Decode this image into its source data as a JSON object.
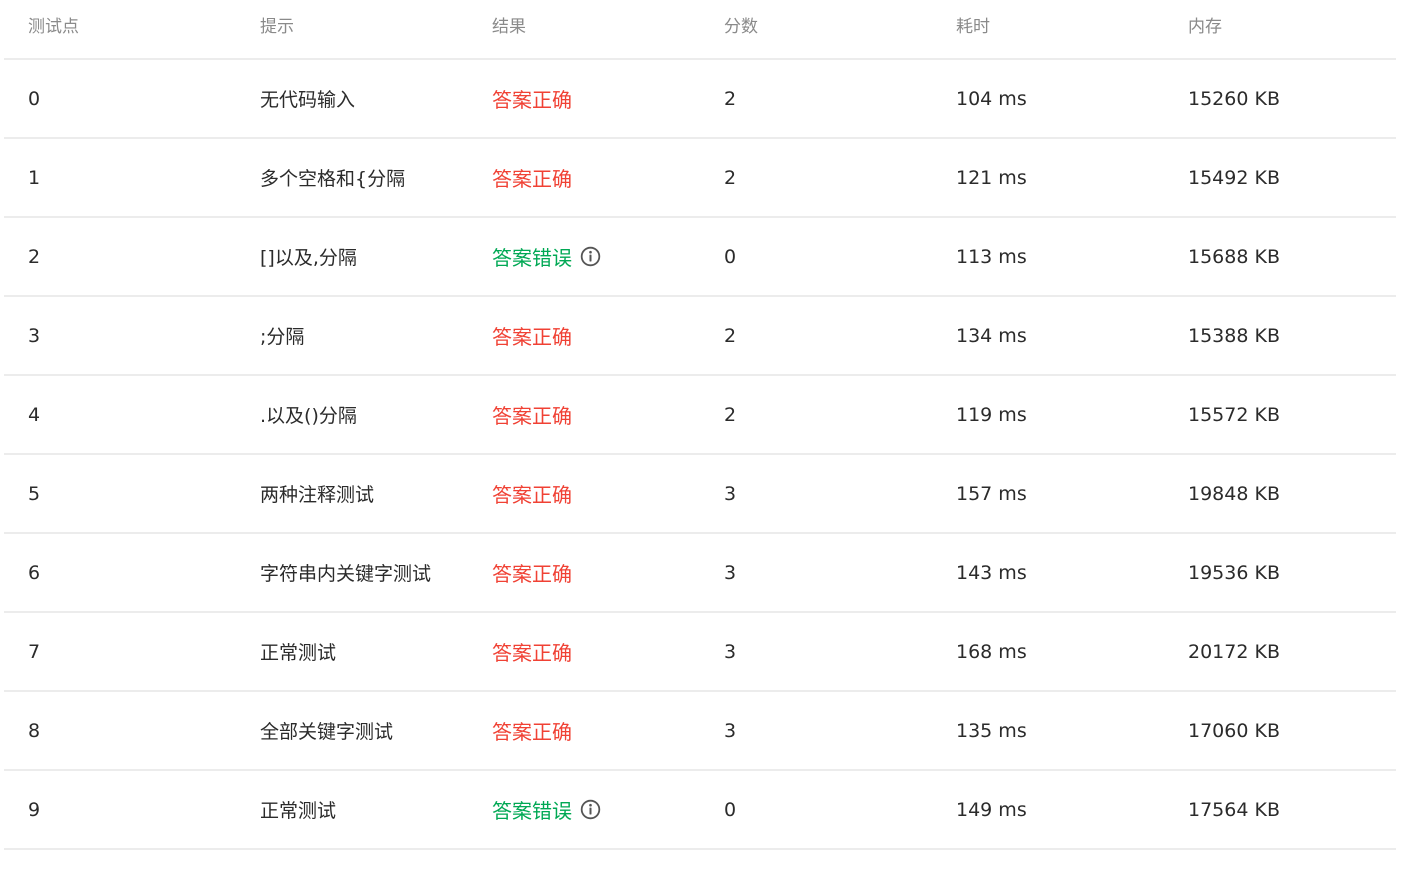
{
  "colors": {
    "correct": "#f04134",
    "wrong": "#00a854",
    "header_text": "#8a8a8a",
    "body_text": "#2b2b2b",
    "divider": "#ececec",
    "info_icon": "#555555"
  },
  "table": {
    "headers": [
      "测试点",
      "提示",
      "结果",
      "分数",
      "耗时",
      "内存"
    ],
    "rows": [
      {
        "id": "0",
        "hint": "无代码输入",
        "result": "答案正确",
        "status": "correct",
        "score": "2",
        "time": "104 ms",
        "memory": "15260 KB"
      },
      {
        "id": "1",
        "hint": "多个空格和{分隔",
        "result": "答案正确",
        "status": "correct",
        "score": "2",
        "time": "121 ms",
        "memory": "15492 KB"
      },
      {
        "id": "2",
        "hint": "[]以及,分隔",
        "result": "答案错误",
        "status": "wrong",
        "score": "0",
        "time": "113 ms",
        "memory": "15688 KB",
        "info_icon": "info-circle-icon"
      },
      {
        "id": "3",
        "hint": ";分隔",
        "result": "答案正确",
        "status": "correct",
        "score": "2",
        "time": "134 ms",
        "memory": "15388 KB"
      },
      {
        "id": "4",
        "hint": ".以及()分隔",
        "result": "答案正确",
        "status": "correct",
        "score": "2",
        "time": "119 ms",
        "memory": "15572 KB"
      },
      {
        "id": "5",
        "hint": "两种注释测试",
        "result": "答案正确",
        "status": "correct",
        "score": "3",
        "time": "157 ms",
        "memory": "19848 KB"
      },
      {
        "id": "6",
        "hint": "字符串内关键字测试",
        "result": "答案正确",
        "status": "correct",
        "score": "3",
        "time": "143 ms",
        "memory": "19536 KB"
      },
      {
        "id": "7",
        "hint": "正常测试",
        "result": "答案正确",
        "status": "correct",
        "score": "3",
        "time": "168 ms",
        "memory": "20172 KB"
      },
      {
        "id": "8",
        "hint": "全部关键字测试",
        "result": "答案正确",
        "status": "correct",
        "score": "3",
        "time": "135 ms",
        "memory": "17060 KB"
      },
      {
        "id": "9",
        "hint": "正常测试",
        "result": "答案错误",
        "status": "wrong",
        "score": "0",
        "time": "149 ms",
        "memory": "17564 KB",
        "info_icon": "info-circle-icon"
      }
    ]
  }
}
